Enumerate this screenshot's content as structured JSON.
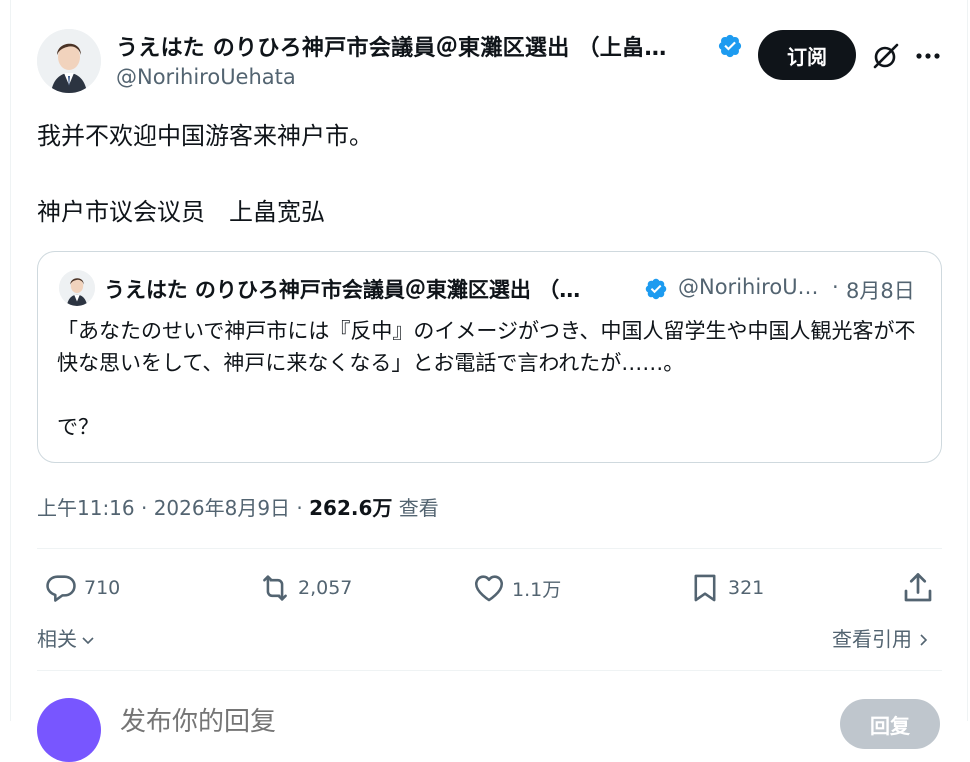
{
  "author": {
    "name": "うえはた のりひろ神戸市会議員＠東灘区選出 （上畠…",
    "handle": "@NorihiroUehata",
    "verified": true
  },
  "subscribe_label": "订阅",
  "tweet": {
    "text": "我并不欢迎中国游客来神户市。",
    "signature": "神户市议会议员　上畠宽弘"
  },
  "quoted": {
    "name": "うえはた のりひろ神戸市会議員＠東灘区選出 （…",
    "handle": "@NorihiroU…",
    "separator": "·",
    "date": "8月8日",
    "text": "「あなたのせいで神戸市には『反中』のイメージがつき、中国人留学生や中国人観光客が不快な思いをして、神戸に来なくなる」とお電話で言われたが……。\n\nで？"
  },
  "meta": {
    "time_date": "上午11:16 · 2026年8月9日 · ",
    "views": "262.6万",
    "views_label": " 查看"
  },
  "actions": {
    "replies": "710",
    "reposts": "2,057",
    "likes": "1.1万",
    "bookmarks": "321"
  },
  "related_label": "相关",
  "view_quotes_label": "查看引用",
  "reply": {
    "placeholder": "发布你的回复",
    "button_label": "回复"
  },
  "colors": {
    "accent": "#1d9bf0",
    "text": "#0f1419",
    "secondary": "#536471"
  }
}
